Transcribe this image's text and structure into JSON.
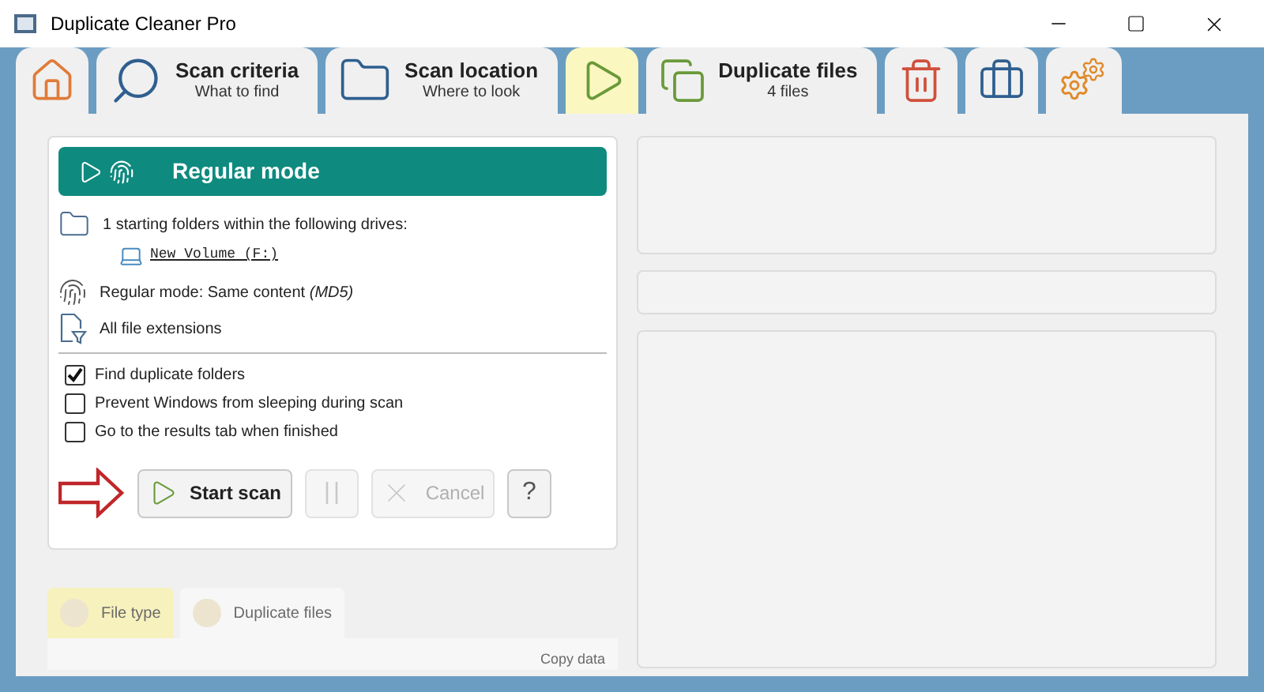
{
  "window": {
    "title": "Duplicate Cleaner Pro"
  },
  "tabs": [
    {
      "kind": "home",
      "selected": false
    },
    {
      "kind": "criteria",
      "title": "Scan criteria",
      "subtitle": "What to find",
      "selected": false
    },
    {
      "kind": "location",
      "title": "Scan location",
      "subtitle": "Where to look",
      "selected": false
    },
    {
      "kind": "scan",
      "selected": true
    },
    {
      "kind": "results",
      "title": "Duplicate files",
      "subtitle": "4 files",
      "selected": false
    },
    {
      "kind": "remove",
      "selected": false
    },
    {
      "kind": "tools",
      "selected": false
    },
    {
      "kind": "settings",
      "selected": false
    }
  ],
  "summary": {
    "header": "Regular mode",
    "folders": "1 starting folders within the following drives:",
    "drive": "New Volume (F:)",
    "mode": "Regular mode: Same content *(MD5)*",
    "extensions": "All file extensions"
  },
  "options": [
    {
      "label": "Find duplicate folders",
      "checked": true
    },
    {
      "label": "Prevent Windows from sleeping during scan",
      "checked": false
    },
    {
      "label": "Go to the results tab when finished",
      "checked": false
    }
  ],
  "buttons": [
    {
      "kind": "start",
      "label": "Start scan",
      "disabled": false
    },
    {
      "kind": "pause",
      "disabled": true
    },
    {
      "kind": "cancel",
      "label": "Cancel",
      "disabled": true
    },
    {
      "kind": "help",
      "label": "?",
      "disabled": false
    }
  ],
  "bottom_tabs": [
    {
      "label": "File type",
      "selected": true
    },
    {
      "label": "Duplicate files",
      "selected": false
    }
  ],
  "bottom_action": "Copy data"
}
